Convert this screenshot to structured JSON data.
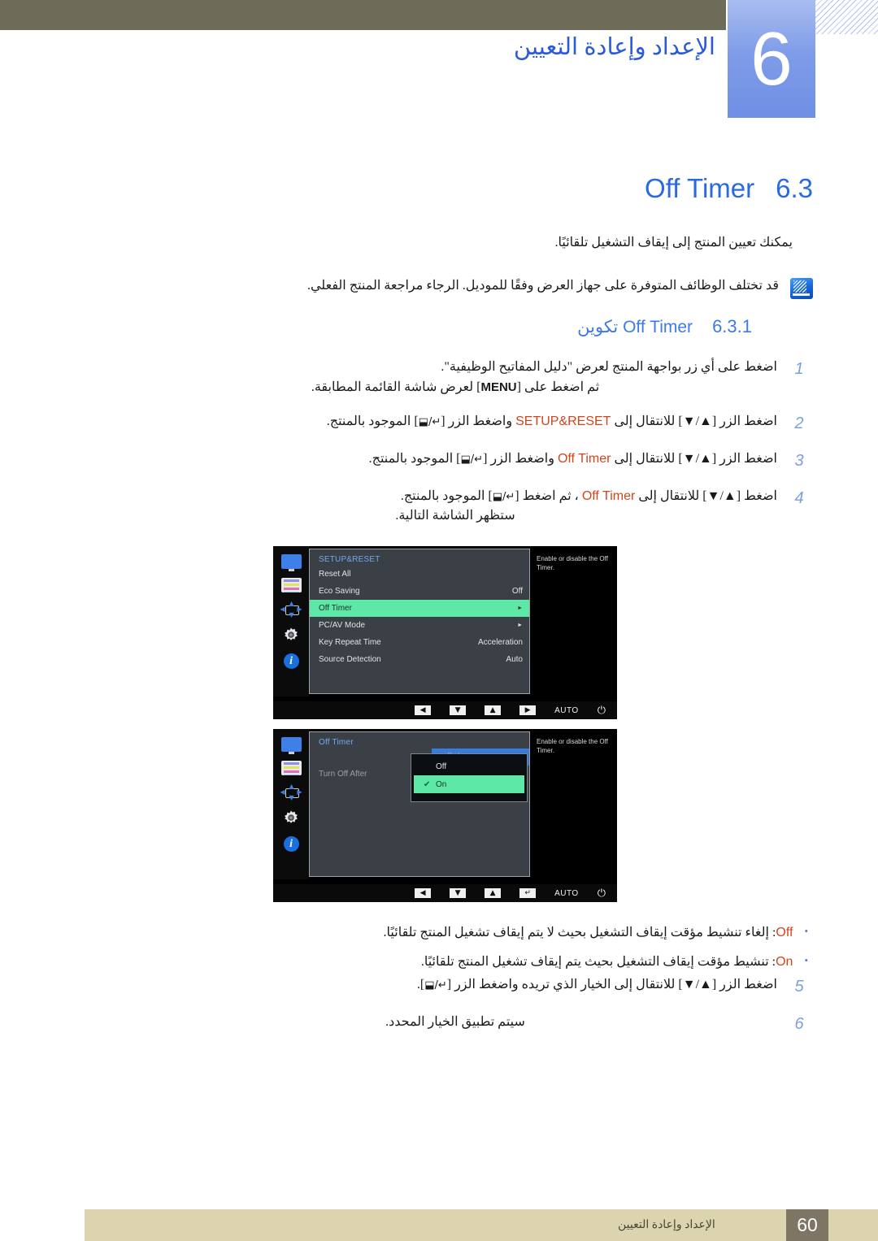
{
  "header": {
    "chapter_number": "6",
    "chapter_title": "الإعداد وإعادة التعيين"
  },
  "section": {
    "number": "6.3",
    "name": "Off Timer",
    "lede": "يمكنك تعيين المنتج إلى إيقاف التشغيل تلقائيًا.",
    "note": "قد تختلف الوظائف المتوفرة على جهاز العرض وفقًا للموديل. الرجاء مراجعة المنتج الفعلي."
  },
  "subsection": {
    "number": "6.3.1",
    "name_ar": "تكوين",
    "name_en": "Off Timer"
  },
  "steps": [
    {
      "num": "1",
      "line1": "اضغط على أي زر بواجهة المنتج لعرض \"دليل المفاتيح الوظيفية\".",
      "line2_pre": "ثم اضغط على [",
      "line2_key": "MENU",
      "line2_post": "] لعرض شاشة القائمة المطابقة."
    },
    {
      "num": "2",
      "l_a": "اضغط الزر [▲/▼] للانتقال إلى",
      "kw": "SETUP&RESET",
      "l_b": "واضغط الزر [",
      "keys": "↵/⬓",
      "l_c": "] الموجود بالمنتج."
    },
    {
      "num": "3",
      "l_a": "اضغط الزر [▲/▼] للانتقال إلى",
      "kw": "Off Timer",
      "l_b": "واضغط الزر [",
      "keys": "↵/⬓",
      "l_c": "] الموجود بالمنتج."
    },
    {
      "num": "4",
      "l_a": "اضغط [▲/▼] للانتقال إلى",
      "kw": "Off Timer",
      "l_b": "، ثم اضغط [",
      "keys": "↵/⬓",
      "l_c": "] الموجود بالمنتج.",
      "line2": "ستظهر الشاشة التالية."
    }
  ],
  "osd_menu_1": {
    "title": "SETUP&RESET",
    "help": "Enable or disable the Off Timer.",
    "rows": [
      {
        "label": "Reset All",
        "value": "",
        "arrow": ""
      },
      {
        "label": "Eco Saving",
        "value": "Off",
        "arrow": ""
      },
      {
        "label": "Off Timer",
        "value": "",
        "arrow": "►"
      },
      {
        "label": "PC/AV Mode",
        "value": "",
        "arrow": "►"
      },
      {
        "label": "Key Repeat Time",
        "value": "Acceleration",
        "arrow": ""
      },
      {
        "label": "Source Detection",
        "value": "Auto",
        "arrow": ""
      }
    ],
    "sidebar_icons": [
      "monitor-icon",
      "color-bars-icon",
      "position-icon",
      "gear-icon",
      "info-icon"
    ],
    "control_bar": {
      "left": "◀",
      "down": "▼",
      "up": "▲",
      "right": "▶",
      "auto": "AUTO",
      "power": "⏻"
    }
  },
  "osd_menu_2": {
    "title": "Off Timer",
    "help": "Enable or disable the Off Timer.",
    "rows": [
      {
        "label": "Off Timer"
      },
      {
        "label": "Turn Off After"
      }
    ],
    "popup_options": [
      {
        "label": "Off",
        "checked": ""
      },
      {
        "label": "On",
        "checked": "✔"
      }
    ],
    "control_bar": {
      "left": "◀",
      "down": "▼",
      "up": "▲",
      "enter": "↵",
      "auto": "AUTO",
      "power": "⏻"
    }
  },
  "bullets": [
    {
      "dot": "•",
      "kw": "Off",
      "text": ": إلغاء تنشيط مؤقت إيقاف التشغيل بحيث لا يتم إيقاف تشغيل المنتج تلقائيًا."
    },
    {
      "dot": "•",
      "kw": "On",
      "text": ": تنشيط مؤقت إيقاف التشغيل بحيث يتم إيقاف تشغيل المنتج تلقائيًا."
    }
  ],
  "steps_tail": [
    {
      "num": "5",
      "l_a": "اضغط الزر [▲/▼] للانتقال إلى الخيار الذي تريده واضغط الزر [",
      "keys": "↵/⬓",
      "l_c": "]."
    },
    {
      "num": "6",
      "line1": "سيتم تطبيق الخيار المحدد."
    }
  ],
  "footer": {
    "page": "60",
    "text": "الإعداد وإعادة التعيين"
  },
  "colors": {
    "header_band": "#6d6c59",
    "chapter_tab": "#7f9ce8",
    "heading_blue": "#2a6ae0",
    "keyword_orange": "#d2441c",
    "osd_highlight_green": "#5de8a8",
    "osd_highlight_blue": "#3b7ddd",
    "footer_band": "#dcd4ae",
    "footer_page_box": "#7e7565"
  }
}
